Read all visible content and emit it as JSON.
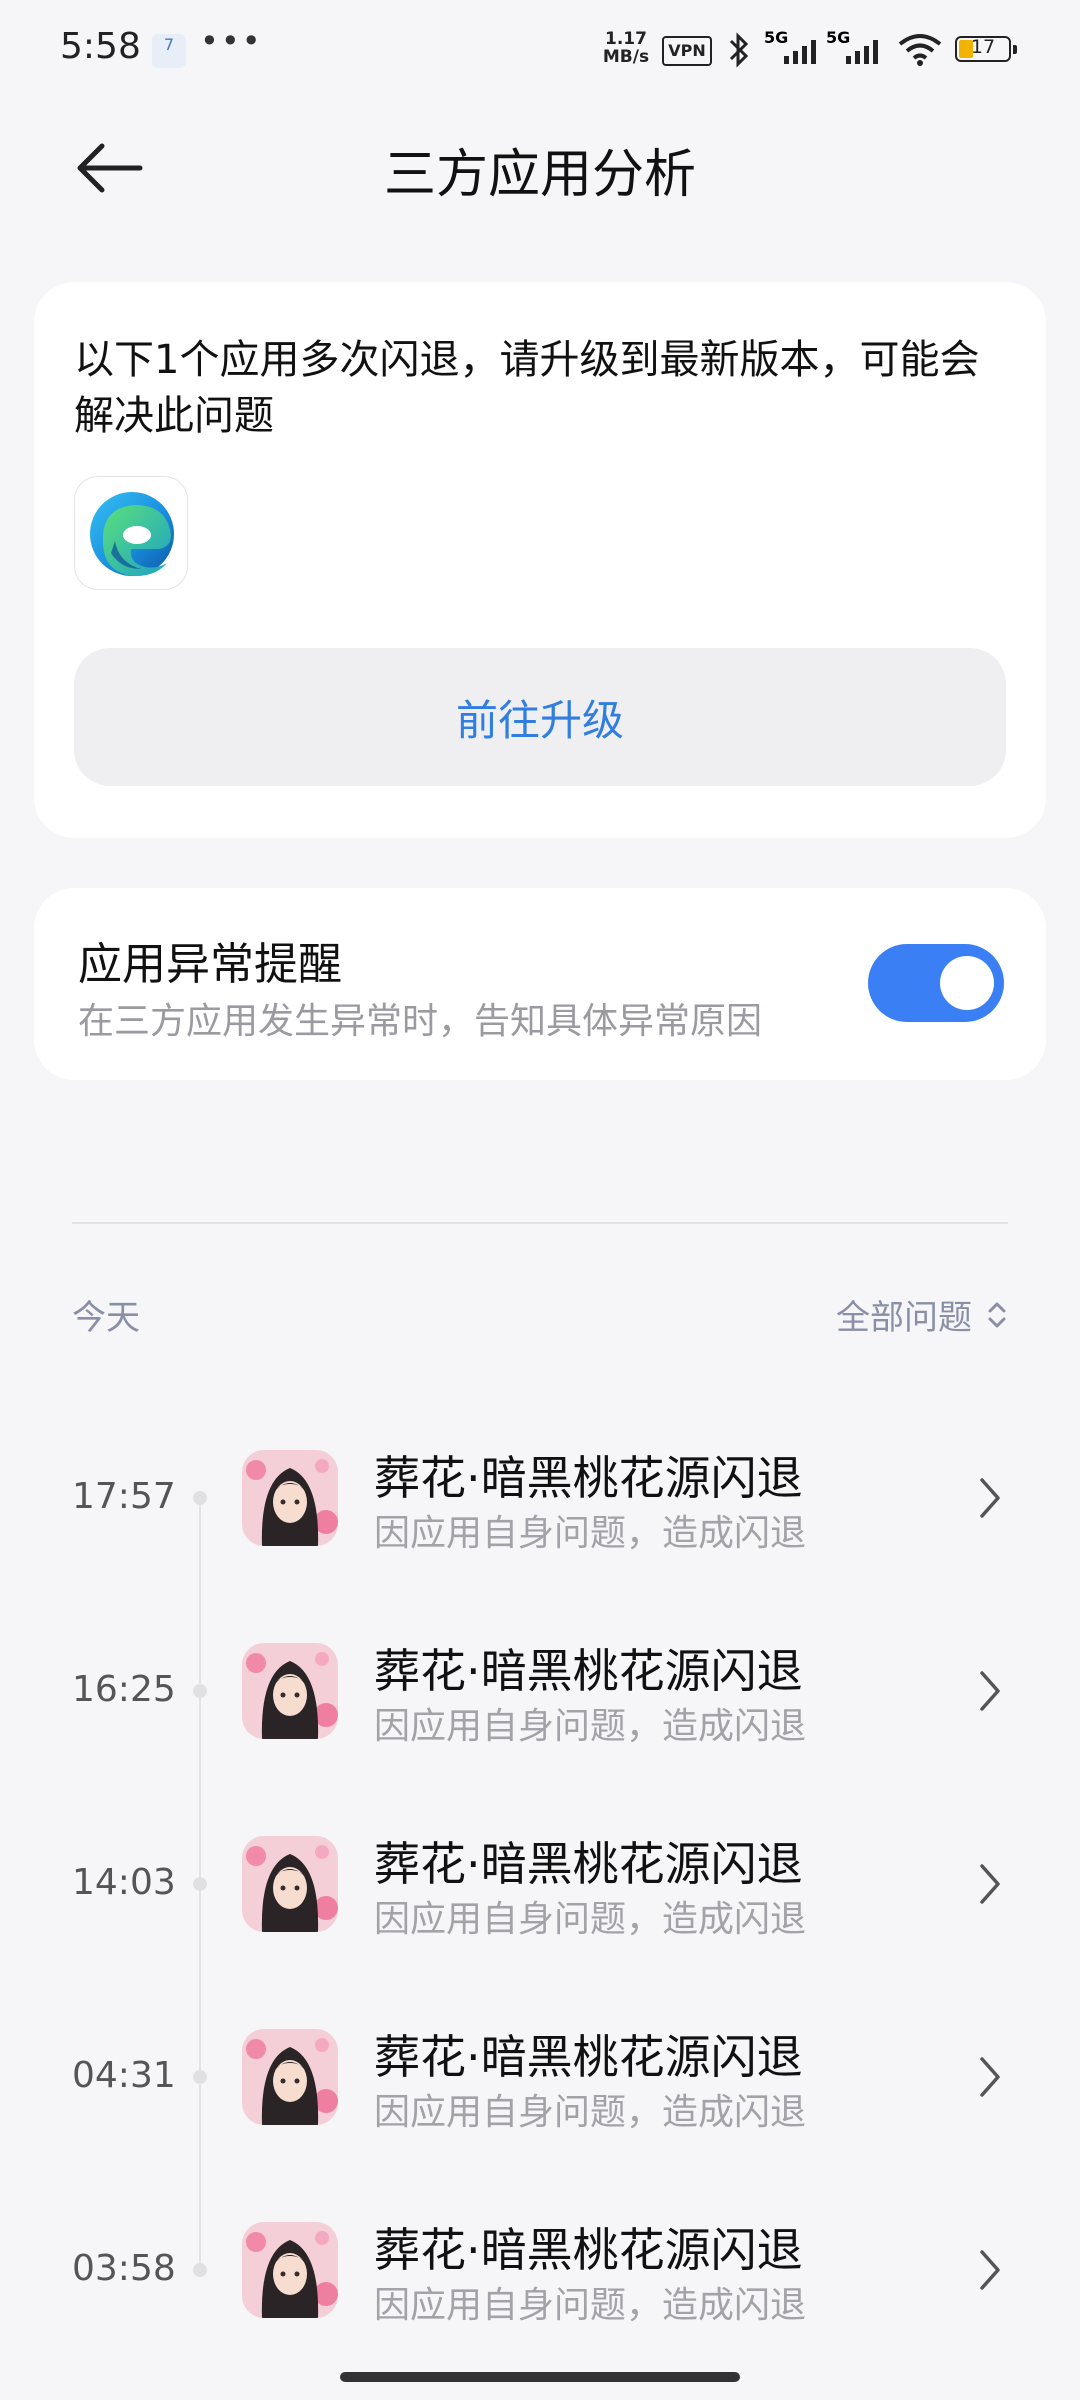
{
  "status_bar": {
    "time": "5:58",
    "calendar_badge": "7",
    "more": "•••",
    "net_speed_value": "1.17",
    "net_speed_unit": "MB/s",
    "vpn": "VPN",
    "signal_1": "5G",
    "signal_2": "5G",
    "battery": "17"
  },
  "header": {
    "title": "三方应用分析"
  },
  "crash_card": {
    "description": "以下1个应用多次闪退，请升级到最新版本，可能会解决此问题",
    "upgrade_label": "前往升级"
  },
  "alert_setting": {
    "title": "应用异常提醒",
    "subtitle": "在三方应用发生异常时，告知具体异常原因",
    "enabled": true
  },
  "list_header": {
    "date": "今天",
    "filter_label": "全部问题"
  },
  "crash_items": [
    {
      "time": "17:57",
      "title": "葬花·暗黑桃花源闪退",
      "reason": "因应用自身问题，造成闪退"
    },
    {
      "time": "16:25",
      "title": "葬花·暗黑桃花源闪退",
      "reason": "因应用自身问题，造成闪退"
    },
    {
      "time": "14:03",
      "title": "葬花·暗黑桃花源闪退",
      "reason": "因应用自身问题，造成闪退"
    },
    {
      "time": "04:31",
      "title": "葬花·暗黑桃花源闪退",
      "reason": "因应用自身问题，造成闪退"
    },
    {
      "time": "03:58",
      "title": "葬花·暗黑桃花源闪退",
      "reason": "因应用自身问题，造成闪退"
    }
  ],
  "colors": {
    "accent": "#3a7ff3",
    "link": "#2f7ee0",
    "background": "#f6f6f8"
  }
}
